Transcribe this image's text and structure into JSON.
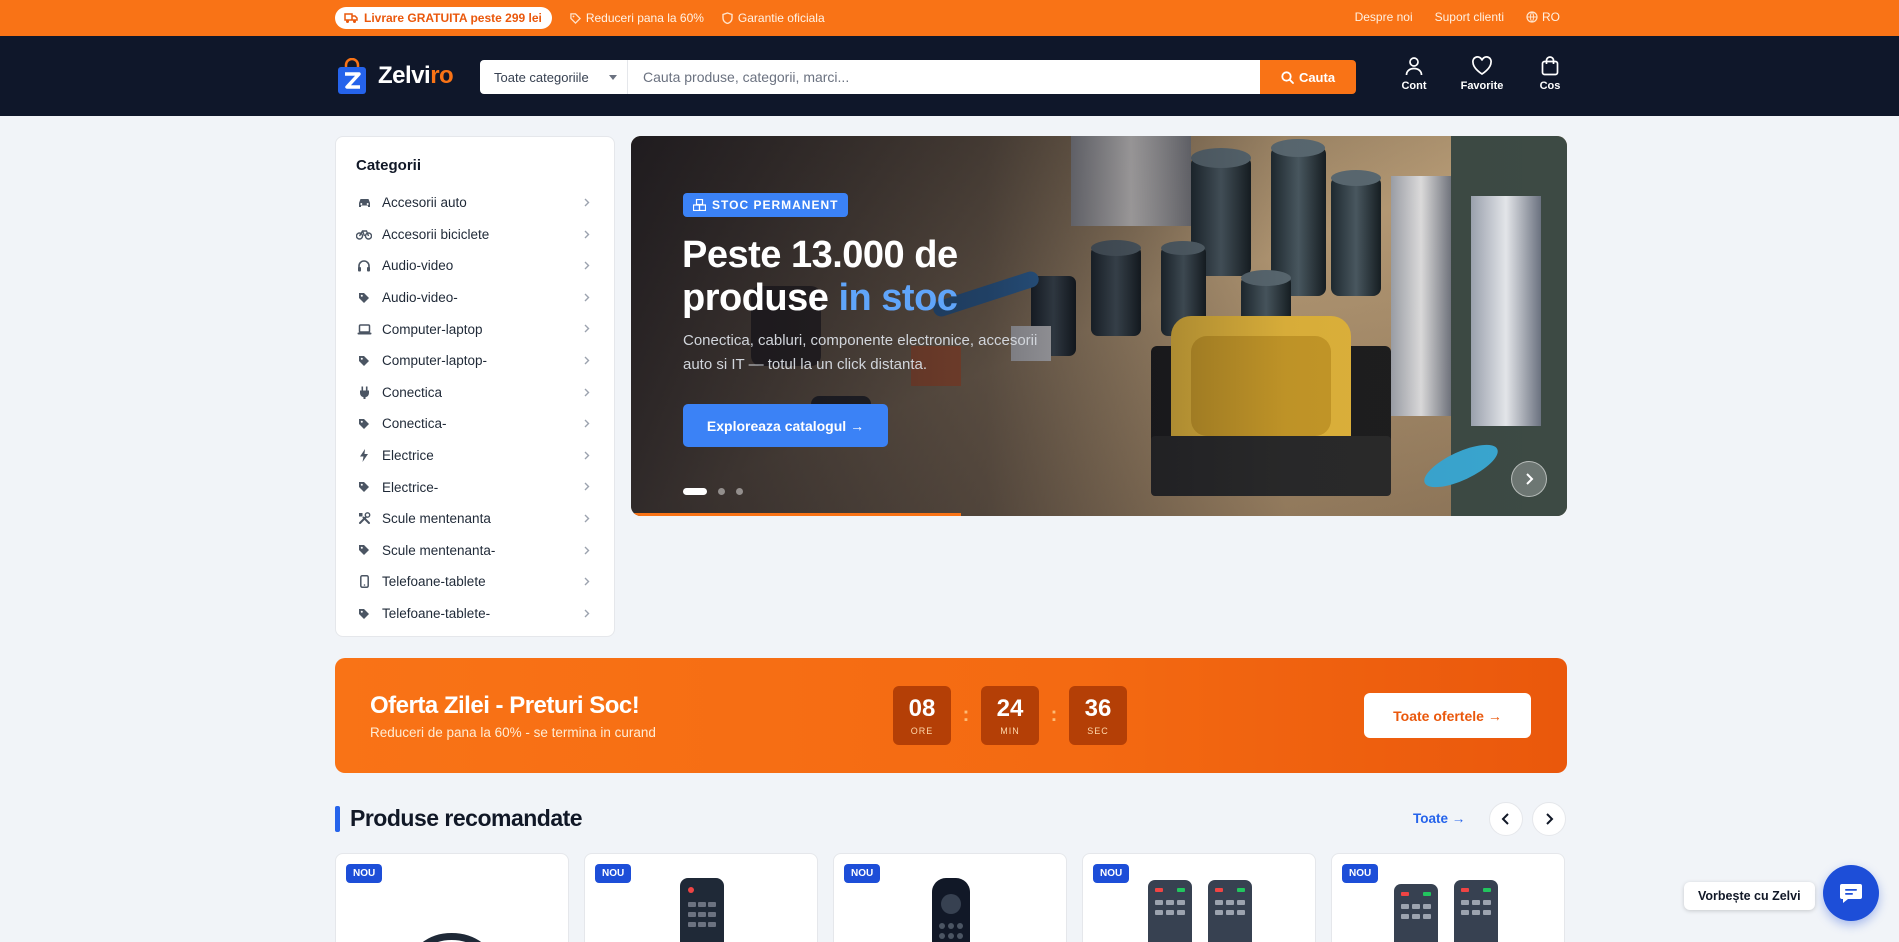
{
  "topbar": {
    "free_shipping": "Livrare GRATUITA peste 299 lei",
    "discounts": "Reduceri pana la 60%",
    "warranty": "Garantie oficiala",
    "about": "Despre noi",
    "support": "Suport clienti",
    "language": "RO"
  },
  "header": {
    "logo_main": "Zelvi",
    "logo_accent": "ro",
    "category_select": "Toate categoriile",
    "search_placeholder": "Cauta produse, categorii, marci...",
    "search_button": "Cauta",
    "account": "Cont",
    "favorites": "Favorite",
    "cart": "Cos"
  },
  "sidebar": {
    "title": "Categorii",
    "items": [
      {
        "label": "Accesorii auto",
        "icon": "car-icon"
      },
      {
        "label": "Accesorii biciclete",
        "icon": "bicycle-icon"
      },
      {
        "label": "Audio-video",
        "icon": "headphones-icon"
      },
      {
        "label": "Audio-video-",
        "icon": "tag-icon"
      },
      {
        "label": "Computer-laptop",
        "icon": "laptop-icon"
      },
      {
        "label": "Computer-laptop-",
        "icon": "tag-icon"
      },
      {
        "label": "Conectica",
        "icon": "plug-icon"
      },
      {
        "label": "Conectica-",
        "icon": "tag-icon"
      },
      {
        "label": "Electrice",
        "icon": "bolt-icon"
      },
      {
        "label": "Electrice-",
        "icon": "tag-icon"
      },
      {
        "label": "Scule mentenanta",
        "icon": "tools-icon"
      },
      {
        "label": "Scule mentenanta-",
        "icon": "tag-icon"
      },
      {
        "label": "Telefoane-tablete",
        "icon": "phone-icon"
      },
      {
        "label": "Telefoane-tablete-",
        "icon": "tag-icon"
      }
    ]
  },
  "hero": {
    "badge": "STOC PERMANENT",
    "title_line1": "Peste 13.000 de",
    "title_line2_plain": "produse",
    "title_line2_accent": "in stoc",
    "subtitle": "Conectica, cabluri, componente electronice, accesorii auto si IT — totul la un click distanta.",
    "cta": "Exploreaza catalogul →",
    "slides_count": 3,
    "active_slide": 1
  },
  "deal": {
    "title": "Oferta Zilei - Preturi Soc!",
    "subtitle": "Reduceri de pana la 60% - se termina in curand",
    "hours": "08",
    "hours_label": "ORE",
    "minutes": "24",
    "minutes_label": "MIN",
    "seconds": "36",
    "seconds_label": "SEC",
    "separator": ":",
    "button": "Toate ofertele →"
  },
  "recommended": {
    "title": "Produse recomandate",
    "see_all": "Toate →",
    "products": [
      {
        "badge": "NOU",
        "image": "cable-image"
      },
      {
        "badge": "NOU",
        "image": "remote-control-image"
      },
      {
        "badge": "NOU",
        "image": "remote-control-image"
      },
      {
        "badge": "NOU",
        "image": "remote-control-pair-image"
      },
      {
        "badge": "NOU",
        "image": "remote-control-pair-image"
      }
    ]
  },
  "chat": {
    "label": "Vorbește cu Zelvi"
  },
  "colors": {
    "accent": "#f97316",
    "header_bg": "#0f172a",
    "primary_blue": "#3b82f6"
  }
}
